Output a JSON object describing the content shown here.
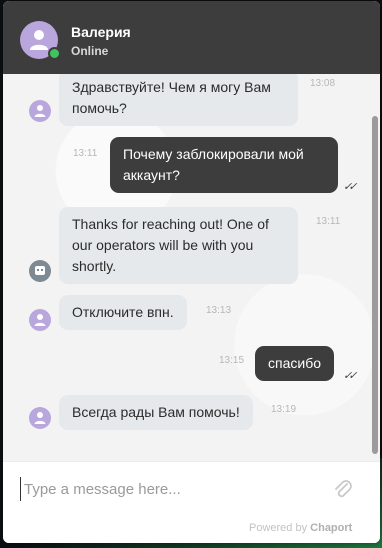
{
  "header": {
    "agent_name": "Валерия",
    "status": "Online"
  },
  "messages": [
    {
      "side": "in",
      "avatar": "user-avatar-icon",
      "text": "Здравствуйте! Чем я могу Вам помочь?",
      "time": "13:08"
    },
    {
      "side": "out",
      "text": "Почему заблокировали мой аккаунт?",
      "time": "13:11",
      "read": "✓✓"
    },
    {
      "side": "in",
      "avatar": "bot-avatar-icon",
      "text": "Thanks for reaching out! One of our operators will be with you shortly.",
      "time": "13:11"
    },
    {
      "side": "in",
      "avatar": "user-avatar-icon",
      "text": "Отключите впн.",
      "time": "13:13"
    },
    {
      "side": "out",
      "text": "спасибо",
      "time": "13:15",
      "read": "✓✓"
    },
    {
      "side": "in",
      "avatar": "user-avatar-icon",
      "text": "Всегда рады Вам помочь!",
      "time": "13:19"
    }
  ],
  "composer": {
    "placeholder": "Type a message here...",
    "attach_icon": "paperclip-icon"
  },
  "footer": {
    "powered_prefix": "Powered by",
    "brand": "Chaport"
  },
  "colors": {
    "header_bg": "#3d3d3d",
    "incoming_bubble": "#e5e9ec",
    "outgoing_bubble": "#3d3d3d",
    "online": "#43c35e",
    "avatar": "#b9a6dd"
  }
}
